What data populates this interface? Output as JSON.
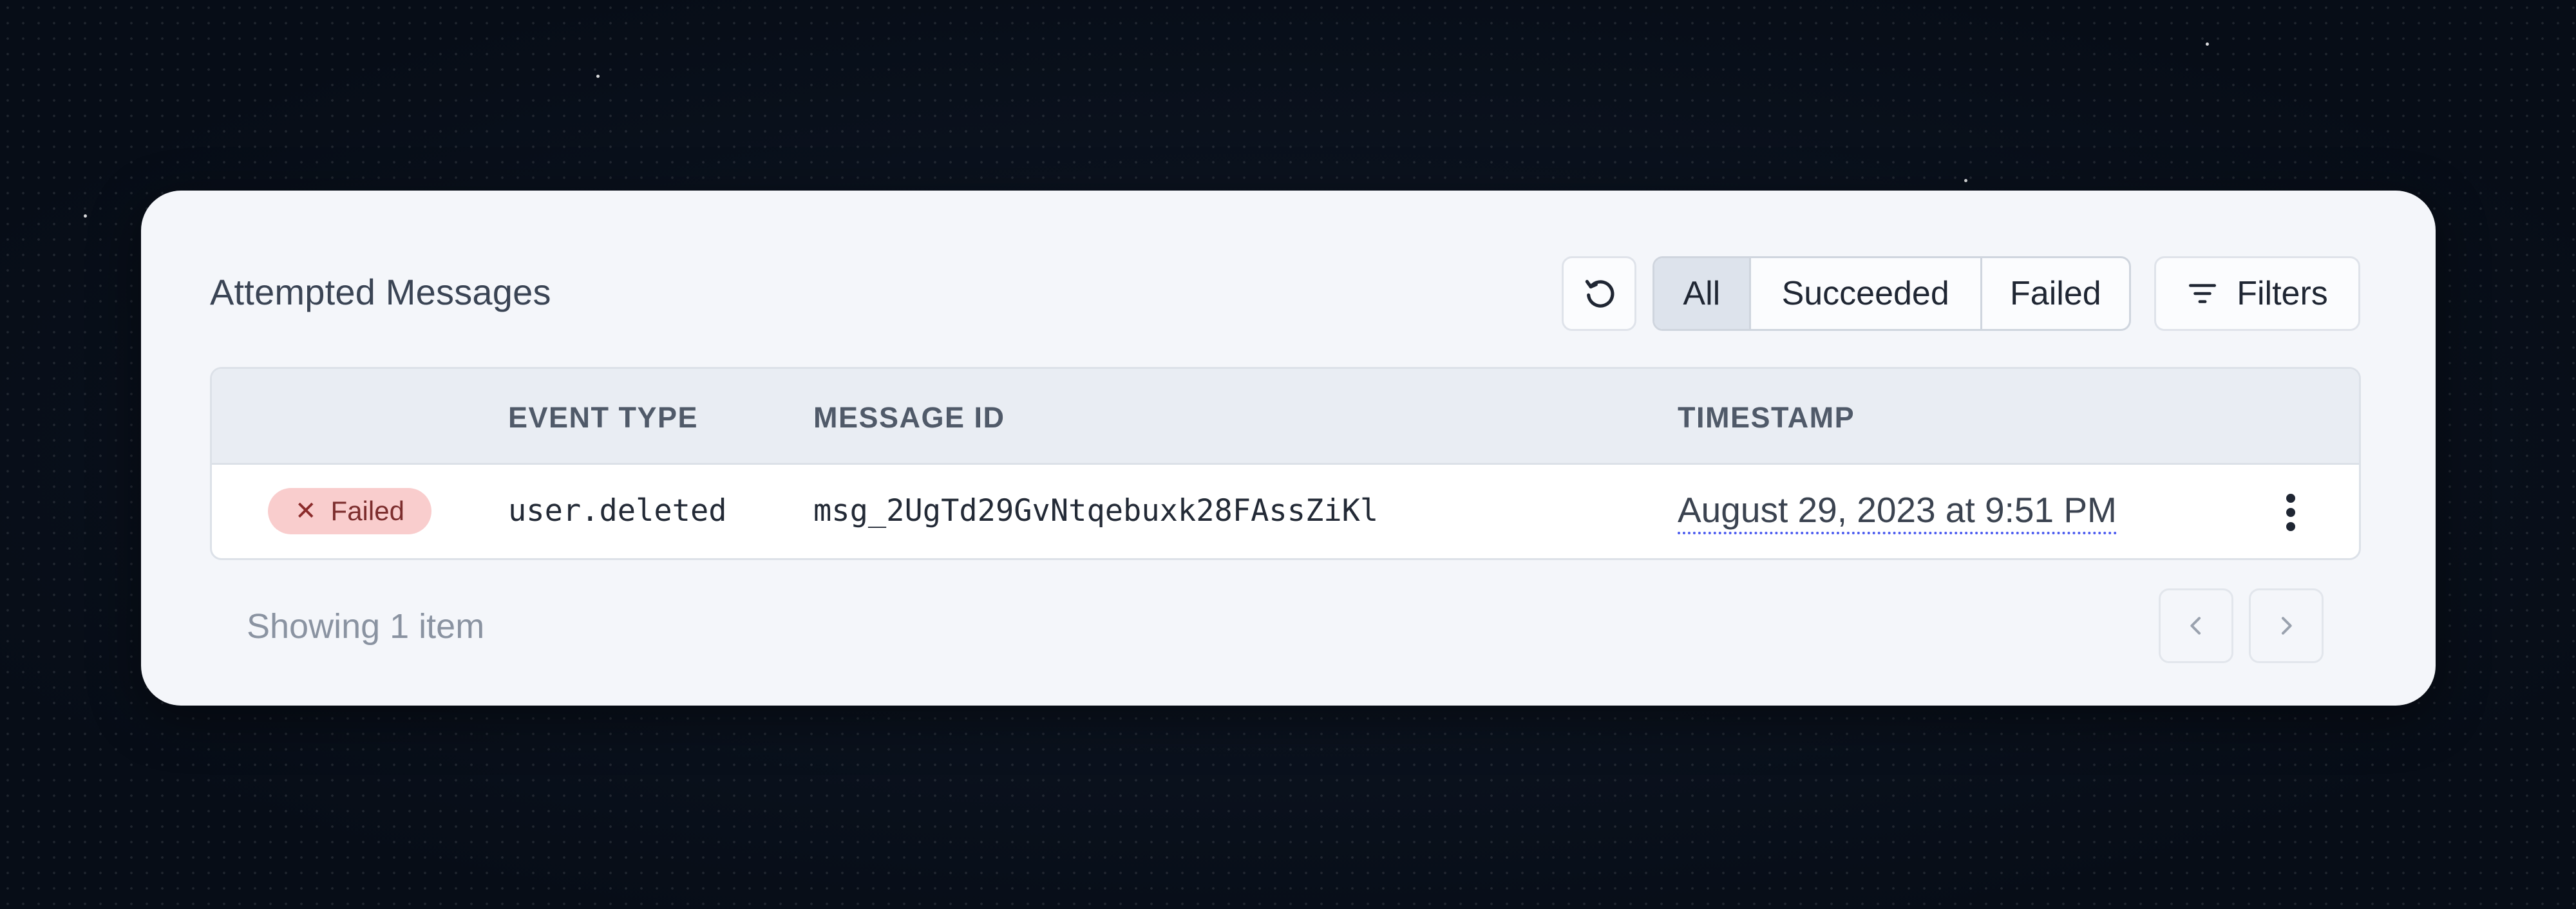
{
  "header": {
    "title": "Attempted Messages",
    "filter_tabs": [
      {
        "label": "All",
        "active": true
      },
      {
        "label": "Succeeded",
        "active": false
      },
      {
        "label": "Failed",
        "active": false
      }
    ],
    "filters_label": "Filters",
    "refresh_icon": "refresh-icon",
    "filters_icon": "filter-lines-icon"
  },
  "table": {
    "columns": [
      "",
      "EVENT TYPE",
      "MESSAGE ID",
      "TIMESTAMP",
      ""
    ],
    "rows": [
      {
        "status": "Failed",
        "status_icon": "x-icon",
        "event_type": "user.deleted",
        "message_id": "msg_2UgTd29GvNtqebuxk28FAssZiKl",
        "timestamp": "August 29, 2023 at 9:51 PM",
        "actions_icon": "kebab-menu-icon"
      }
    ]
  },
  "footer": {
    "showing_text": "Showing 1 item",
    "prev_icon": "chevron-left-icon",
    "next_icon": "chevron-right-icon"
  },
  "colors": {
    "background": "#0a111d",
    "card": "#f4f6fa",
    "failed_badge_bg": "#f9cdcd",
    "failed_badge_text": "#7c2d2d",
    "timestamp_underline": "#4c5cf0",
    "active_tab_bg": "#dde3ec"
  }
}
